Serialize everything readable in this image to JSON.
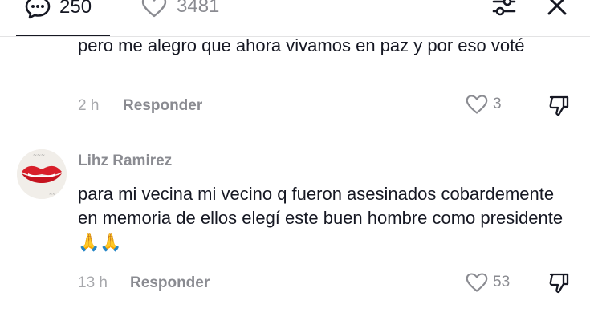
{
  "header": {
    "comments_count": "250",
    "likes_count": "3481"
  },
  "comments": [
    {
      "text": "pero me alegro que ahora vivamos en paz y por eso voté",
      "time": "2 h",
      "reply_label": "Responder",
      "likes": "3"
    },
    {
      "author": "Lihz Ramirez",
      "text": "para mi vecina mi vecino q fueron asesinados cobardemente en memoria de ellos elegí este buen hombre como presidente 🙏🙏",
      "time": "13 h",
      "reply_label": "Responder",
      "likes": "53"
    }
  ],
  "icons": [
    "comment-icon",
    "heart-icon",
    "filter-icon",
    "close-icon",
    "dislike-icon",
    "avatar-lips"
  ],
  "colors": {
    "text": "#161823",
    "muted": "#8a8b91",
    "divider": "#e3e3e4",
    "lips": "#d81f2a"
  }
}
